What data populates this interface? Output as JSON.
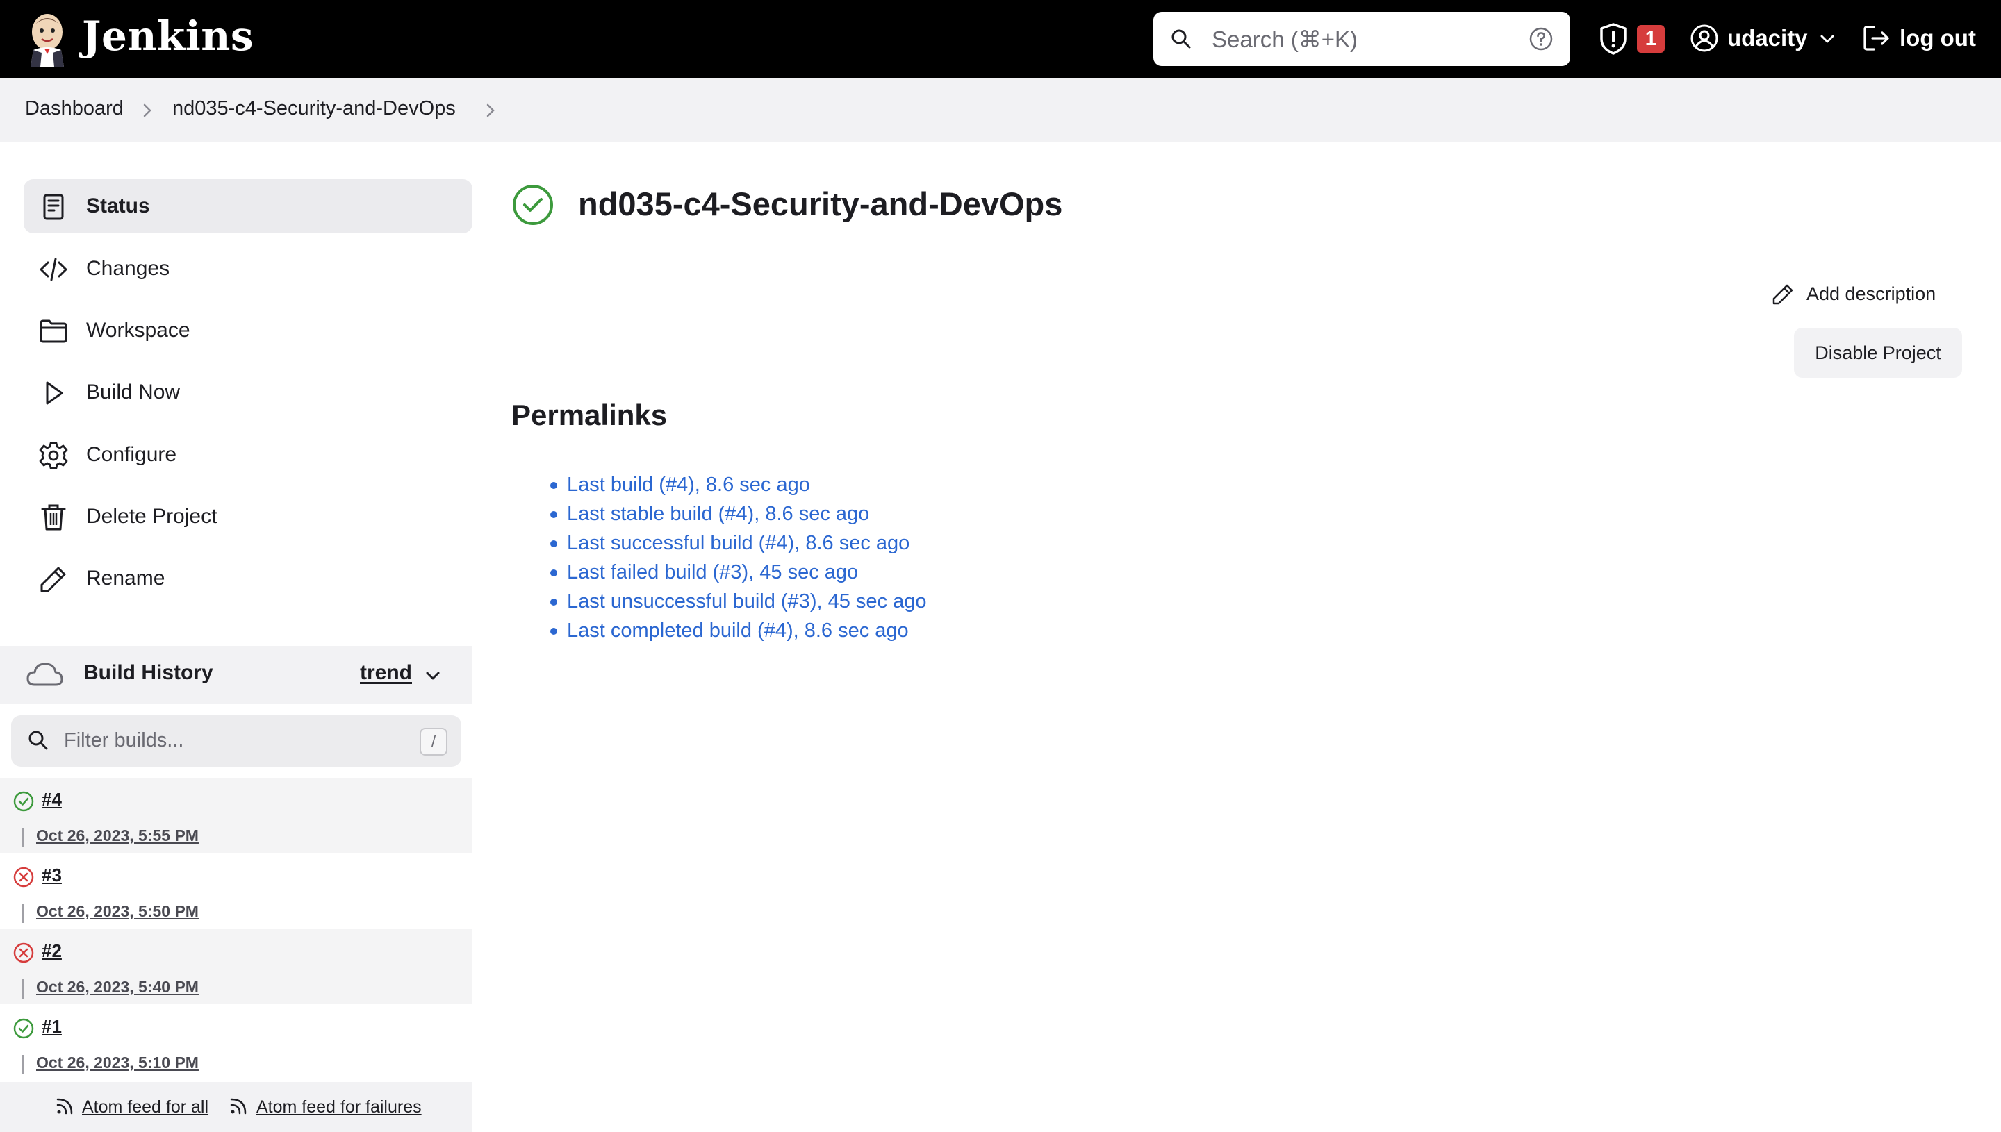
{
  "header": {
    "brand": "Jenkins",
    "search_placeholder": "Search (⌘+K)",
    "security_badge": "1",
    "user": "udacity",
    "logout": "log out"
  },
  "breadcrumb": [
    "Dashboard",
    "nd035-c4-Security-and-DevOps"
  ],
  "sidebar": {
    "items": [
      {
        "label": "Status",
        "icon": "status-icon",
        "active": true
      },
      {
        "label": "Changes",
        "icon": "code-icon"
      },
      {
        "label": "Workspace",
        "icon": "folder-icon"
      },
      {
        "label": "Build Now",
        "icon": "play-icon"
      },
      {
        "label": "Configure",
        "icon": "gear-icon"
      },
      {
        "label": "Delete Project",
        "icon": "trash-icon"
      },
      {
        "label": "Rename",
        "icon": "pencil-icon"
      }
    ]
  },
  "build_history": {
    "title": "Build History",
    "trend": "trend",
    "filter_placeholder": "Filter builds...",
    "filter_shortcut": "/",
    "builds": [
      {
        "number": "#4",
        "date": "Oct 26, 2023, 5:55 PM",
        "status": "success"
      },
      {
        "number": "#3",
        "date": "Oct 26, 2023, 5:50 PM",
        "status": "failed"
      },
      {
        "number": "#2",
        "date": "Oct 26, 2023, 5:40 PM",
        "status": "failed"
      },
      {
        "number": "#1",
        "date": "Oct 26, 2023, 5:10 PM",
        "status": "success"
      }
    ],
    "feed_all": "Atom feed for all",
    "feed_failures": "Atom feed for failures"
  },
  "main": {
    "title": "nd035-c4-Security-and-DevOps",
    "add_description": "Add description",
    "disable_project": "Disable Project",
    "permalinks_heading": "Permalinks",
    "permalinks": [
      "Last build (#4), 8.6 sec ago",
      "Last stable build (#4), 8.6 sec ago",
      "Last successful build (#4), 8.6 sec ago",
      "Last failed build (#3), 45 sec ago",
      "Last unsuccessful build (#3), 45 sec ago",
      "Last completed build (#4), 8.6 sec ago"
    ]
  },
  "colors": {
    "success": "#3d9a3d",
    "failure": "#d63c3c",
    "link": "#2b67d1",
    "header_bg": "#000000"
  }
}
